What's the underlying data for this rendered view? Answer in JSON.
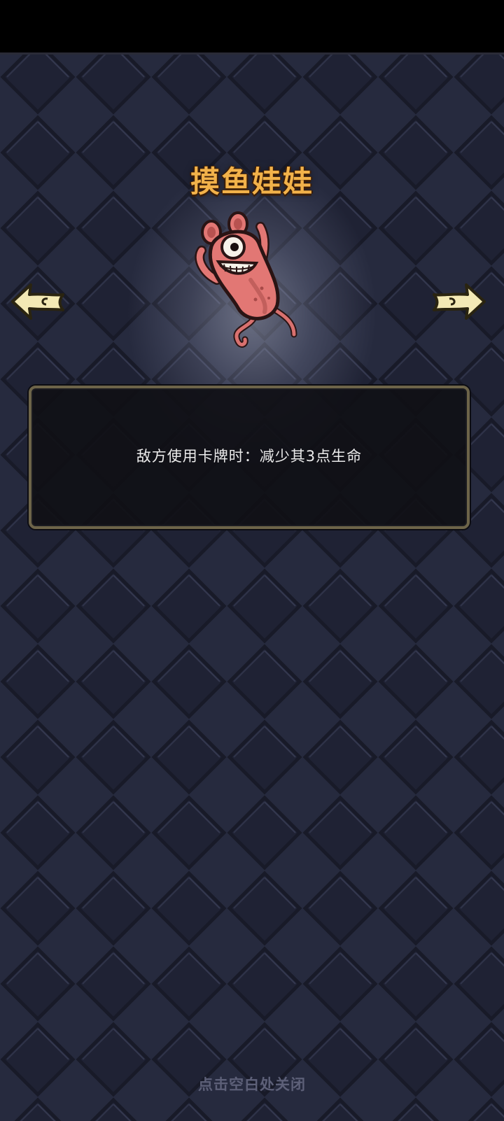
{
  "card": {
    "title": "摸鱼娃娃",
    "description": "敌方使用卡牌时：减少其3点生命"
  },
  "navigation": {
    "prev_icon": "arrow-left-icon",
    "next_icon": "arrow-right-icon"
  },
  "footer": {
    "close_hint": "点击空白处关闭"
  },
  "colors": {
    "background": "#262a3e",
    "tile": "#1d2031",
    "title": "#f2b24a",
    "panel_border": "#6d6449",
    "panel_fill": "#101016",
    "arrow": "#f3e9b5",
    "monster_body": "#e27774"
  }
}
